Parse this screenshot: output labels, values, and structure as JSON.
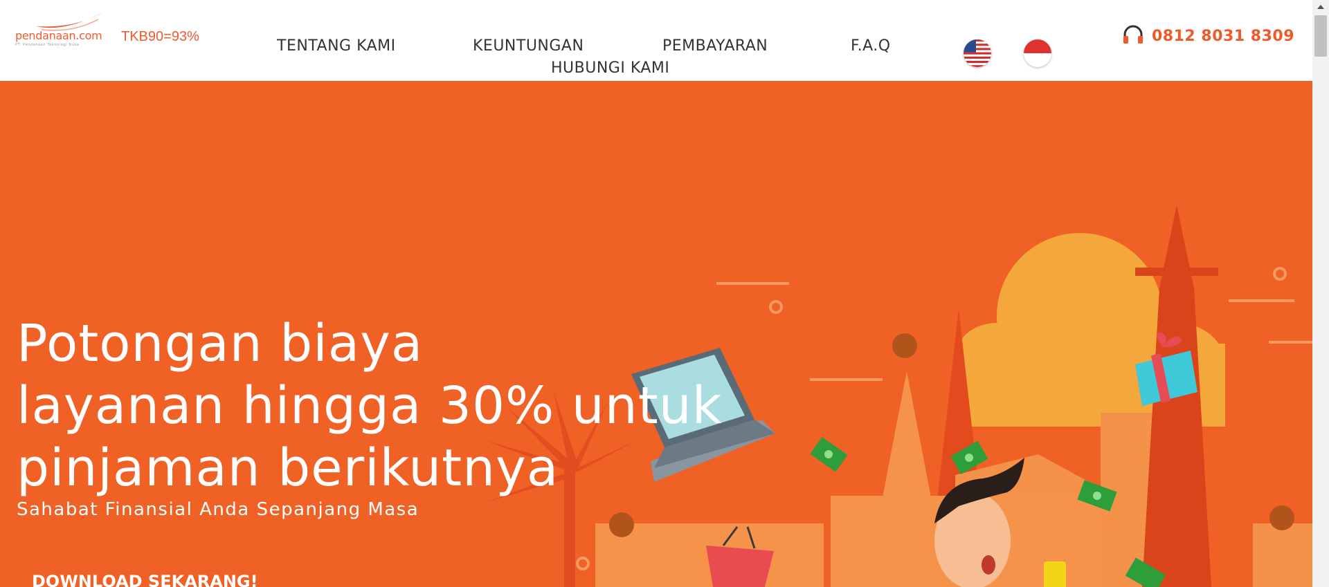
{
  "header": {
    "logo_text": "pendanaan.com",
    "logo_tagline": "PT. Pendanaan Teknologi Nusa",
    "tkb": "TKB90=93%",
    "nav": [
      {
        "label": "TENTANG KAMI"
      },
      {
        "label": "KEUNTUNGAN"
      },
      {
        "label": "PEMBAYARAN"
      },
      {
        "label": "F.A.Q"
      },
      {
        "label": "HUBUNGI KAMI"
      }
    ],
    "languages": [
      {
        "icon": "us-flag-icon"
      },
      {
        "icon": "id-flag-icon"
      }
    ],
    "phone": "0812 8031 8309",
    "phone_icon": "headset-icon"
  },
  "hero": {
    "title": "Potongan biaya\nlayanan hingga 30% untuk\npinjaman berikutnya",
    "subtitle": "Sahabat Finansial Anda Sepanjang Masa",
    "cta": "DOWNLOAD SEKARANG!"
  },
  "colors": {
    "brand": "#f05a28",
    "hero_bg": "#ef6125",
    "nav_text": "#333333"
  }
}
